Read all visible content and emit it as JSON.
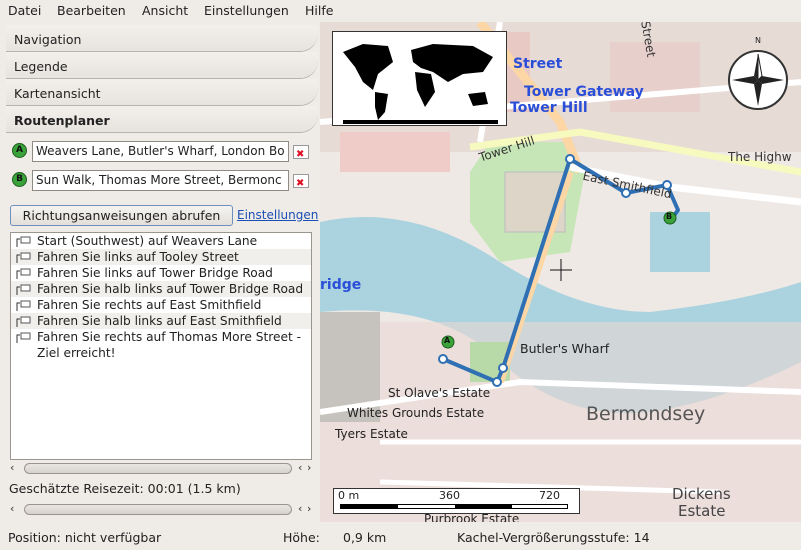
{
  "menubar": {
    "items": [
      "Datei",
      "Bearbeiten",
      "Ansicht",
      "Einstellungen",
      "Hilfe"
    ]
  },
  "panels": {
    "navigation": "Navigation",
    "legend": "Legende",
    "map_view": "Kartenansicht",
    "route_planner": "Routenplaner"
  },
  "route": {
    "start_marker": "A",
    "end_marker": "B",
    "start_value": "Weavers Lane, Butler's Wharf, London Bo",
    "end_value": "Sun Walk, Thomas More Street, Bermonc",
    "get_directions_label": "Richtungsanweisungen abrufen",
    "settings_link": "Einstellungen",
    "directions": [
      "Start (Southwest) auf Weavers Lane",
      "Fahren Sie links auf Tooley Street",
      "Fahren Sie links auf Tower Bridge Road",
      "Fahren Sie halb links auf Tower Bridge Road",
      "Fahren Sie rechts auf East Smithfield",
      "Fahren Sie halb links auf East Smithfield",
      "Fahren Sie rechts auf Thomas More Street -",
      "Ziel erreicht!"
    ],
    "estimated_time": "Geschätzte Reisezeit: 00:01 (1.5 km)"
  },
  "map": {
    "labels": {
      "street": "Street",
      "tower_gateway": "Tower Gateway",
      "tower_hill_station": "Tower Hill",
      "tower_hill_road": "Tower Hill",
      "east_smithfield": "East Smithfield",
      "the_highway": "The Highw",
      "bridge": "ridge",
      "butlers_wharf": "Butler's Wharf",
      "st_olaves": "St Olave's Estate",
      "whites_grounds": "Whites Grounds Estate",
      "tyers": "Tyers Estate",
      "bermondsey": "Bermondsey",
      "dickens": "Dickens",
      "dickens2": "Estate",
      "purbrook": "Purbrook Estate",
      "tower_street": "Street"
    },
    "compass_n": "N",
    "scale": {
      "zero": "0 m",
      "mid": "360",
      "end": "720"
    },
    "route_markers": {
      "a": "A",
      "b": "B"
    }
  },
  "statusbar": {
    "position": "Position: nicht verfügbar",
    "altitude_label": "Höhe:",
    "altitude_value": "0,9 km",
    "tile_zoom": "Kachel-Vergrößerungsstufe: 14"
  }
}
